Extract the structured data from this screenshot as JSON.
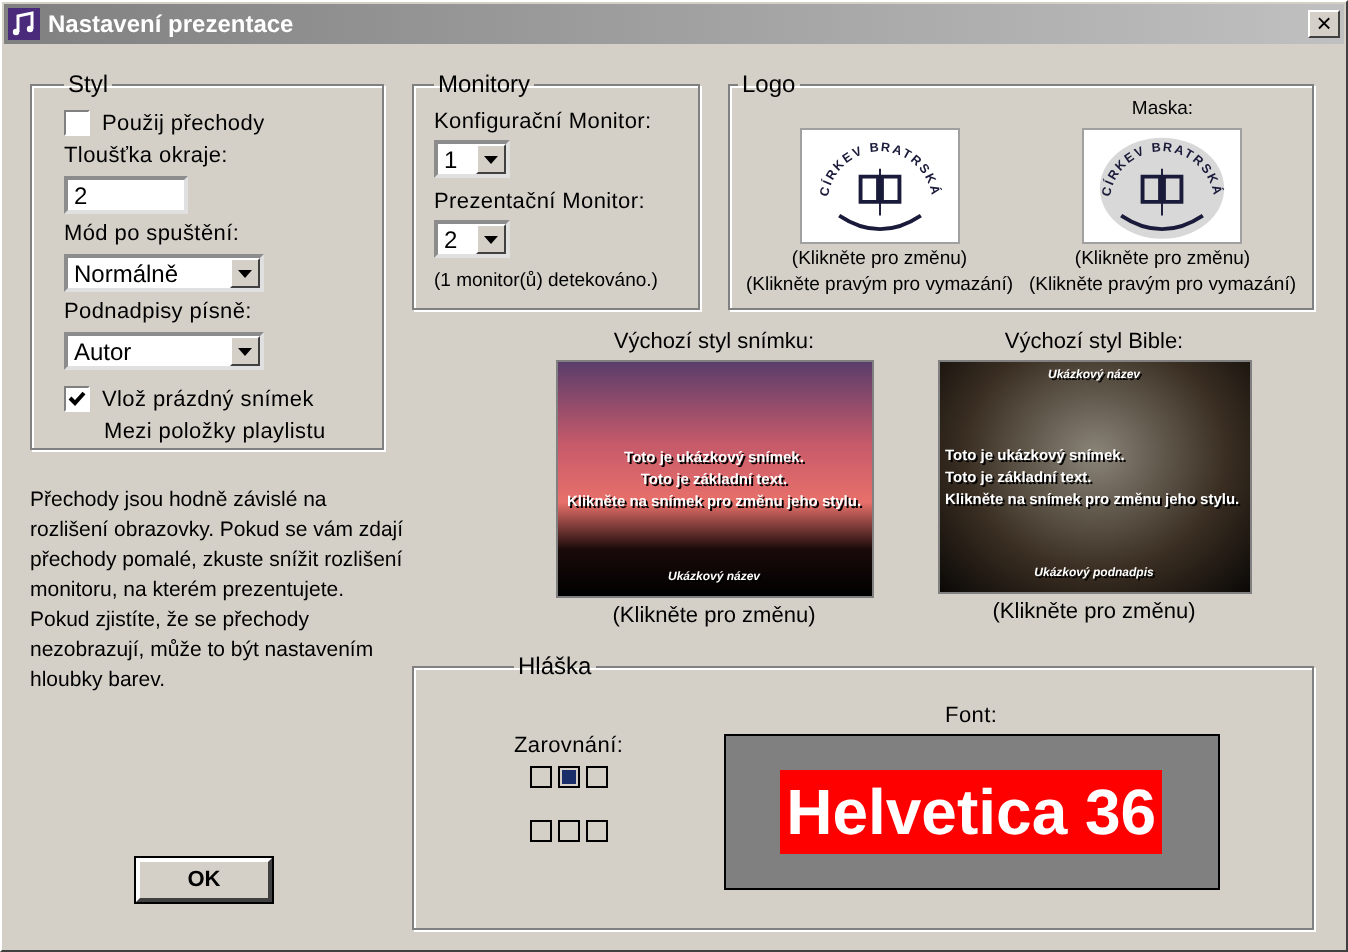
{
  "window": {
    "title": "Nastavení prezentace",
    "close": "×"
  },
  "styl": {
    "title": "Styl",
    "transitions": {
      "label": "Použij přechody",
      "checked": false
    },
    "border": {
      "label": "Tloušťka okraje:",
      "value": "2"
    },
    "start_mode": {
      "label": "Mód po spuštění:",
      "value": "Normálně"
    },
    "subtitles": {
      "label": "Podnadpisy písně:",
      "value": "Autor"
    },
    "blank": {
      "label": "Vlož prázdný snímek",
      "checked": true,
      "note": "Mezi položky playlistu"
    }
  },
  "monitors": {
    "title": "Monitory",
    "config_label": "Konfigurační Monitor:",
    "config_value": "1",
    "present_label": "Prezentační Monitor:",
    "present_value": "2",
    "detected": "(1 monitor(ů) detekováno.)"
  },
  "logo": {
    "title": "Logo",
    "items": [
      {
        "logo_text": "CÍRKEV BRATRSKÁ",
        "shadow": false,
        "click": "(Klikněte pro změnu)",
        "right_click": "(Klikněte pravým pro vymazání)"
      },
      {
        "heading": "Maska:",
        "logo_text": "CÍRKEV BRATRSKÁ",
        "shadow": true,
        "click": "(Klikněte pro změnu)",
        "right_click": "(Klikněte pravým pro vymazání)"
      }
    ]
  },
  "previews": [
    {
      "kind": "slide",
      "heading": "Výchozí styl snímku:",
      "lines": [
        "Toto je ukázkový snímek.",
        "Toto je základní text.",
        "Klikněte na snímek pro změnu jeho stylu."
      ],
      "bottom_text": "Ukázkový název",
      "click": "(Klikněte pro změnu)"
    },
    {
      "kind": "bible",
      "heading": "Výchozí styl Bible:",
      "top_text": "Ukázkový název",
      "lines": [
        "Toto je ukázkový snímek.",
        "Toto je základní text.",
        "Klikněte na snímek pro změnu jeho stylu."
      ],
      "bottom_text": "Ukázkový podnadpis",
      "click": "(Klikněte pro změnu)"
    }
  ],
  "description": "Přechody jsou hodně závislé na rozlišení obrazovky. Pokud se vám zdají přechody pomalé, zkuste snížit rozlišení monitoru, na kterém prezentujete. Pokud zjistíte, že se přechody nezobrazují, může to být nastavením hloubky barev.",
  "ok_button": "OK",
  "message": {
    "title": "Hláška",
    "align_label": "Zarovnání:",
    "align_rows": [
      [
        {
          "selected": false
        },
        {
          "selected": true
        },
        {
          "selected": false
        }
      ],
      [
        {
          "selected": false
        },
        {
          "selected": false
        },
        {
          "selected": false
        }
      ]
    ],
    "font_label": "Font:",
    "font_sample": "Helvetica 36"
  }
}
